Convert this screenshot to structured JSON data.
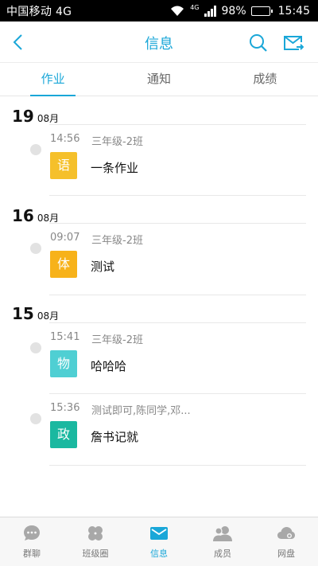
{
  "status_bar": {
    "carrier": "中国移动 4G",
    "net_badge": "4G",
    "battery": "98%",
    "battery_level": 0.98,
    "time": "15:45"
  },
  "header": {
    "title": "信息",
    "back_icon": "back-arrow-icon",
    "search_icon": "search-icon",
    "mail_icon": "mail-send-icon"
  },
  "tabs": [
    {
      "label": "作业",
      "active": true
    },
    {
      "label": "通知",
      "active": false
    },
    {
      "label": "成绩",
      "active": false
    }
  ],
  "groups": [
    {
      "day": "19",
      "month": "08月",
      "items": [
        {
          "time": "14:56",
          "class": "三年级-2班",
          "badge": "语",
          "badge_color": "#f5c02b",
          "title": "一条作业"
        }
      ]
    },
    {
      "day": "16",
      "month": "08月",
      "items": [
        {
          "time": "09:07",
          "class": "三年级-2班",
          "badge": "体",
          "badge_color": "#f7b21a",
          "title": "测试"
        }
      ]
    },
    {
      "day": "15",
      "month": "08月",
      "items": [
        {
          "time": "15:41",
          "class": "三年级-2班",
          "badge": "物",
          "badge_color": "#4fcfd3",
          "title": "哈哈哈"
        },
        {
          "time": "15:36",
          "class": "测试即可,陈同学,邓...",
          "badge": "政",
          "badge_color": "#1ab8a0",
          "title": "詹书记就"
        }
      ]
    }
  ],
  "bottom_nav": [
    {
      "label": "群聊",
      "icon": "chat-icon",
      "active": false
    },
    {
      "label": "班级圈",
      "icon": "clover-icon",
      "active": false
    },
    {
      "label": "信息",
      "icon": "mail-icon",
      "active": true
    },
    {
      "label": "成员",
      "icon": "members-icon",
      "active": false
    },
    {
      "label": "网盘",
      "icon": "cloud-icon",
      "active": false
    }
  ],
  "colors": {
    "accent": "#1aa7d8",
    "inactive_icon": "#a8a8a8"
  }
}
